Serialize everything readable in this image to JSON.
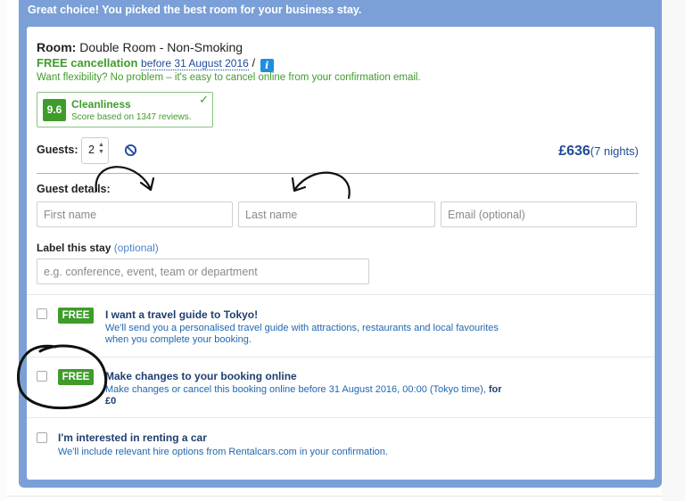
{
  "banner": "Great choice! You picked the best room for your business stay.",
  "room": {
    "label": "Room:",
    "name": "Double Room - Non-Smoking"
  },
  "cancellation": {
    "title": "FREE cancellation",
    "date": "before 31 August 2016",
    "slash": "/",
    "info_icon": "i",
    "flexibility": "Want flexibility? No problem – it's easy to cancel online from your confirmation email."
  },
  "cleanliness": {
    "score": "9.6",
    "title": "Cleanliness",
    "subtitle": "Score based on 1347 reviews.",
    "icon": "checkmark-icon"
  },
  "guests": {
    "label": "Guests:",
    "value": "2",
    "icon": "no-entry-icon"
  },
  "price": {
    "amount": "£636",
    "nights": "(7 nights)"
  },
  "guest_details": {
    "label": "Guest details:",
    "first_name_placeholder": "First name",
    "last_name_placeholder": "Last name",
    "email_placeholder": "Email (optional)"
  },
  "label_stay": {
    "label": "Label this stay",
    "optional": "(optional)",
    "placeholder": "e.g. conference, event, team or department"
  },
  "options": [
    {
      "badge": "FREE",
      "title": "I want a travel guide to Tokyo!",
      "desc_line1": "We'll send you a personalised travel guide with attractions, restaurants and local favourites",
      "desc_line2": "when you complete your booking."
    },
    {
      "badge": "FREE",
      "title": "Make changes to your booking online",
      "desc_line1": "Make changes or cancel this booking online before 31 August 2016, 00:00 (Tokyo time),",
      "desc_bold_a": "for",
      "desc_bold_b": "£0"
    },
    {
      "title": "I'm interested in renting a car",
      "desc_line1": "We'll include relevant hire options from Rentalcars.com in your confirmation."
    }
  ],
  "colors": {
    "banner_bg": "#7ba0d8",
    "green": "#3f9c2b",
    "blue_text": "#1f4b99",
    "annotation": "#111111"
  },
  "annotations": [
    "curved-arrow-right",
    "curved-arrow-left",
    "circle-around-checkbox"
  ]
}
